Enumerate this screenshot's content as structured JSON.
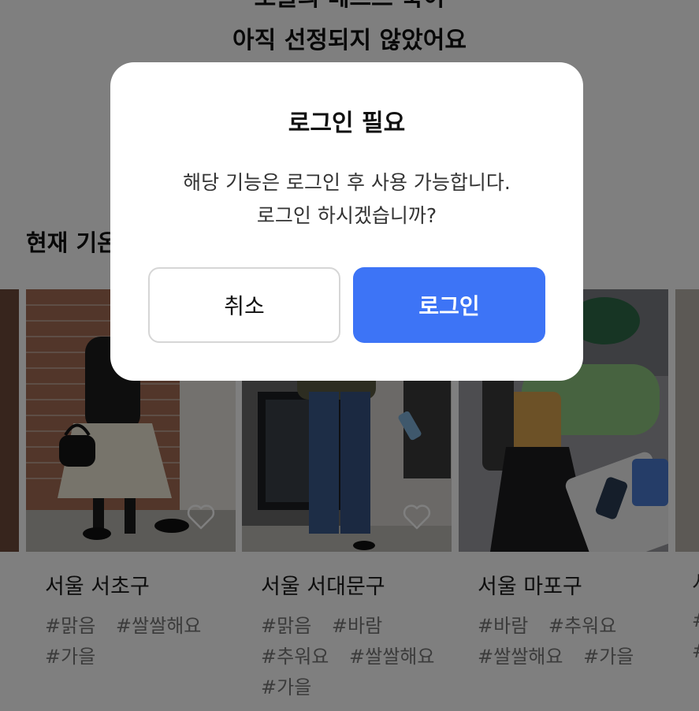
{
  "background": {
    "headline_line1": "오늘의 베스트 룩이",
    "headline_line2": "아직 선정되지 않았어요",
    "section_title": "현재 기온",
    "cards": [
      {
        "region": "서울 서초구",
        "tags": [
          "#맑음",
          "#쌀쌀해요",
          "#가을"
        ]
      },
      {
        "region": "서울 서대문구",
        "tags": [
          "#맑음",
          "#바람",
          "#추워요",
          "#쌀쌀해요",
          "#가을"
        ]
      },
      {
        "region": "서울 마포구",
        "tags": [
          "#바람",
          "#추워요",
          "#쌀쌀해요",
          "#가을"
        ]
      }
    ],
    "partial_card": {
      "region": "서",
      "tag1": "#",
      "tag2": "#"
    }
  },
  "modal": {
    "title": "로그인 필요",
    "message_line1": "해당 기능은 로그인 후 사용 가능합니다.",
    "message_line2": "로그인 하시겠습니까?",
    "cancel_label": "취소",
    "login_label": "로그인"
  },
  "colors": {
    "primary": "#3d74f6",
    "overlay": "rgba(0,0,0,0.5)",
    "tag_text": "#777777"
  },
  "icons": {
    "favorite": "heart-outline-icon"
  }
}
